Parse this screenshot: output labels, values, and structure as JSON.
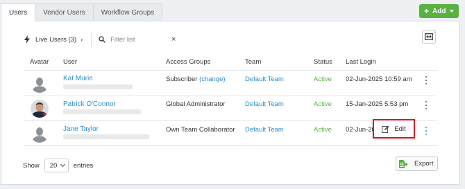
{
  "tabs": [
    {
      "label": "Users",
      "active": true
    },
    {
      "label": "Vendor Users",
      "active": false
    },
    {
      "label": "Workflow Groups",
      "active": false
    }
  ],
  "add_button": {
    "label": "Add",
    "color": "#58b23f"
  },
  "toolbar": {
    "live_users_label": "Live Users (3)",
    "chevron": "›",
    "filter_placeholder": "Filter list",
    "clear_icon": "×"
  },
  "table": {
    "headers": [
      "Avatar",
      "User",
      "Access Groups",
      "Team",
      "Status",
      "Last Login"
    ],
    "rows": [
      {
        "name": "Kat Murie",
        "access_group": "Subscriber",
        "change_label": "(change)",
        "team": "Default Team",
        "status": "Active",
        "last_login": "02-Jun-2025 10:59 am",
        "avatar": "placeholder-avatar"
      },
      {
        "name": "Patrick O'Connor",
        "access_group": "Global Administrator",
        "team": "Default Team",
        "status": "Active",
        "last_login": "15-Jan-2025 5:53 pm",
        "avatar": "photo-avatar"
      },
      {
        "name": "Jane Taylor",
        "access_group": "Own Team Collaborator",
        "team": "Default Team",
        "status": "Active",
        "last_login": "02-Jun-202",
        "avatar": "placeholder-avatar"
      }
    ]
  },
  "popup": {
    "edit_label": "Edit",
    "icon": "edit-icon",
    "highlight_color": "#d7191f"
  },
  "footer": {
    "show_label": "Show",
    "entries_value": "20",
    "entries_label": "entries",
    "export_label": "Export"
  },
  "colors": {
    "link": "#2a8fcf",
    "active_status": "#58b23f"
  }
}
